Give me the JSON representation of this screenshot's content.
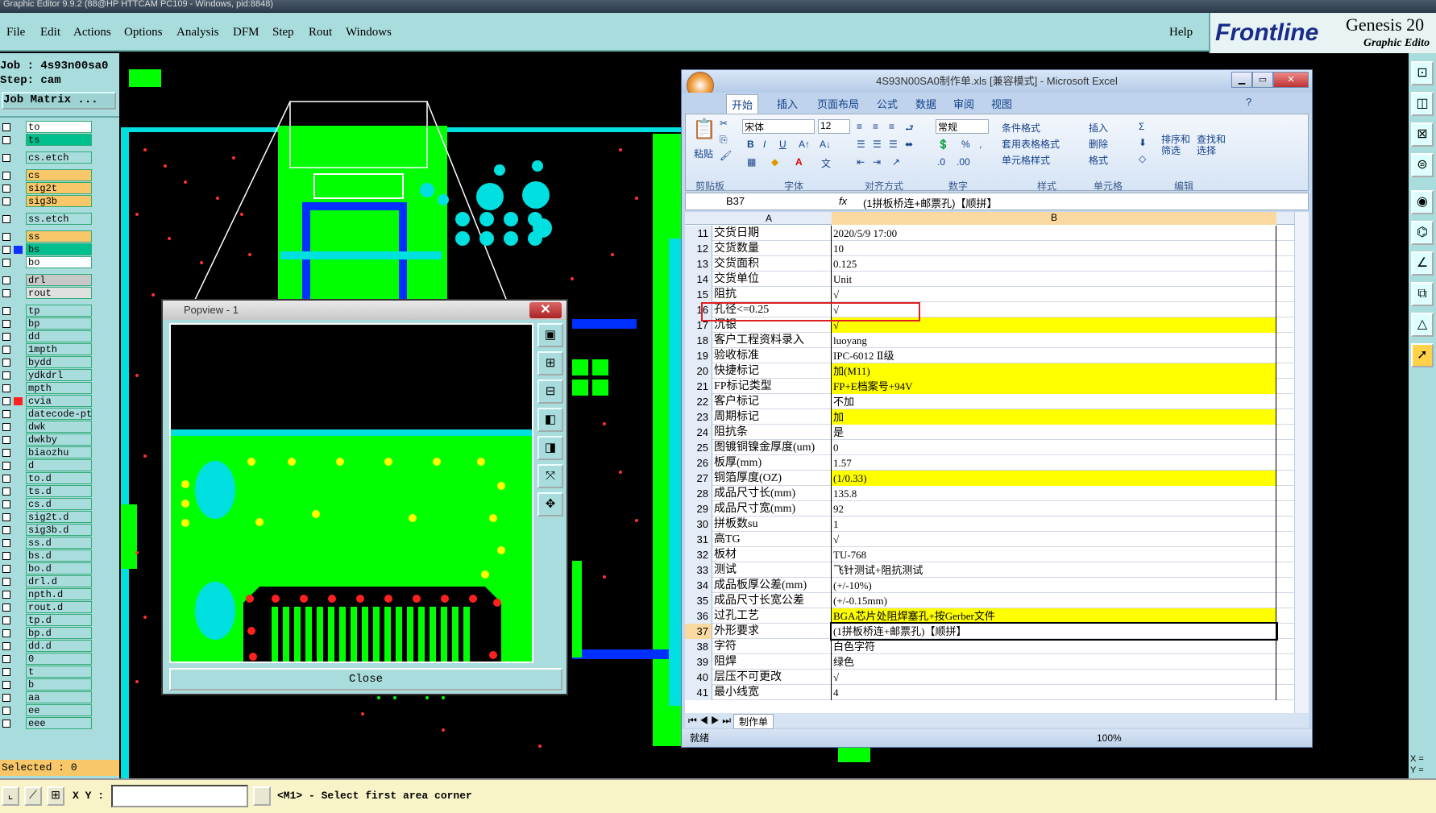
{
  "titlebar": {
    "text": "Graphic Editor 9.9.2 (88@HP HTTCAM PC109 - Windows, pid:8848)"
  },
  "menu": {
    "items": [
      "File",
      "Edit",
      "Actions",
      "Options",
      "Analysis",
      "DFM",
      "Step",
      "Rout",
      "Windows"
    ],
    "help": "Help"
  },
  "brand": {
    "logo": "Frontline",
    "product": "Genesis 20",
    "subtitle": "Graphic Edito"
  },
  "job": {
    "job_label": "Job : 4s93n00sa0",
    "step_label": "Step: cam",
    "matrix_button": "Job Matrix ..."
  },
  "layers": [
    {
      "name": "to",
      "color": "#ffffff"
    },
    {
      "name": "ts",
      "color": "#00c090"
    },
    {
      "name": "cs.etch",
      "color": "#a9dcdc"
    },
    {
      "name": "cs",
      "color": "#f7c76a"
    },
    {
      "name": "sig2t",
      "color": "#f7c76a"
    },
    {
      "name": "sig3b",
      "color": "#f7c76a"
    },
    {
      "name": "ss.etch",
      "color": "#a9dcdc"
    },
    {
      "name": "ss",
      "color": "#f7c76a"
    },
    {
      "name": "bs",
      "color": "#00c090"
    },
    {
      "name": "bo",
      "color": "#ffffff"
    },
    {
      "name": "drl",
      "color": "#c8c8c8"
    },
    {
      "name": "rout",
      "color": "#e0e0e0"
    },
    {
      "name": "tp",
      "color": "#a9dcdc"
    },
    {
      "name": "bp",
      "color": "#a9dcdc"
    },
    {
      "name": "dd",
      "color": "#a9dcdc"
    },
    {
      "name": "1mpth",
      "color": "#a9dcdc"
    },
    {
      "name": "bydd",
      "color": "#a9dcdc"
    },
    {
      "name": "ydkdrl",
      "color": "#a9dcdc"
    },
    {
      "name": "mpth",
      "color": "#a9dcdc"
    },
    {
      "name": "cvia",
      "color": "#a9dcdc"
    },
    {
      "name": "datecode-pt",
      "color": "#a9dcdc"
    },
    {
      "name": "dwk",
      "color": "#a9dcdc"
    },
    {
      "name": "dwkby",
      "color": "#a9dcdc"
    },
    {
      "name": "biaozhu",
      "color": "#a9dcdc"
    },
    {
      "name": "d",
      "color": "#a9dcdc"
    },
    {
      "name": "to.d",
      "color": "#a9dcdc"
    },
    {
      "name": "ts.d",
      "color": "#a9dcdc"
    },
    {
      "name": "cs.d",
      "color": "#a9dcdc"
    },
    {
      "name": "sig2t.d",
      "color": "#a9dcdc"
    },
    {
      "name": "sig3b.d",
      "color": "#a9dcdc"
    },
    {
      "name": "ss.d",
      "color": "#a9dcdc"
    },
    {
      "name": "bs.d",
      "color": "#a9dcdc"
    },
    {
      "name": "bo.d",
      "color": "#a9dcdc"
    },
    {
      "name": "drl.d",
      "color": "#a9dcdc"
    },
    {
      "name": "npth.d",
      "color": "#a9dcdc"
    },
    {
      "name": "rout.d",
      "color": "#a9dcdc"
    },
    {
      "name": "tp.d",
      "color": "#a9dcdc"
    },
    {
      "name": "bp.d",
      "color": "#a9dcdc"
    },
    {
      "name": "dd.d",
      "color": "#a9dcdc"
    },
    {
      "name": "0",
      "color": "#a9dcdc"
    },
    {
      "name": "t",
      "color": "#a9dcdc"
    },
    {
      "name": "b",
      "color": "#a9dcdc"
    },
    {
      "name": "aa",
      "color": "#a9dcdc"
    },
    {
      "name": "ee",
      "color": "#a9dcdc"
    },
    {
      "name": "eee",
      "color": "#a9dcdc"
    }
  ],
  "selected": "Selected : 0",
  "statusbar": {
    "xy_label": "X Y :",
    "xy_value": "",
    "prompt": "<M1> - Select first area corner"
  },
  "popview": {
    "title": "Popview - 1",
    "close_label": "Close"
  },
  "excel": {
    "title": "4S93N00SA0制作单.xls [兼容模式] - Microsoft Excel",
    "tabs": [
      "开始",
      "插入",
      "页面布局",
      "公式",
      "数据",
      "审阅",
      "视图"
    ],
    "groups": [
      "剪贴板",
      "字体",
      "对齐方式",
      "数字",
      "样式",
      "单元格",
      "编辑"
    ],
    "font_name": "宋体",
    "font_size": "12",
    "number_format": "常规",
    "buttons": {
      "paste": "粘贴",
      "cond": "条件格式",
      "table": "套用表格格式",
      "cellstyle": "单元格样式",
      "insert": "插入",
      "delete": "删除",
      "format": "格式",
      "sort": "排序和\n筛选",
      "find": "查找和\n选择"
    },
    "name_box": "B37",
    "formula": "(1拼板桥连+邮票孔)【顺拼】",
    "col_a": "A",
    "col_b": "B",
    "rows": [
      {
        "n": "11",
        "a": "交货日期",
        "b": "2020/5/9 17:00",
        "y": false
      },
      {
        "n": "12",
        "a": "交货数量",
        "b": "10",
        "y": false
      },
      {
        "n": "13",
        "a": "交货面积",
        "b": "0.125",
        "y": false
      },
      {
        "n": "14",
        "a": "交货单位",
        "b": "Unit",
        "y": false
      },
      {
        "n": "15",
        "a": "阻抗",
        "b": "√",
        "y": false
      },
      {
        "n": "16",
        "a": "孔径<=0.25",
        "b": "√",
        "y": false
      },
      {
        "n": "17",
        "a": "沉银",
        "b": "√",
        "y": true
      },
      {
        "n": "18",
        "a": "客户工程资料录入",
        "b": "luoyang",
        "y": false
      },
      {
        "n": "19",
        "a": "验收标准",
        "b": "IPC-6012 Ⅱ级",
        "y": false
      },
      {
        "n": "20",
        "a": "快捷标记",
        "b": "加(M11)",
        "y": true
      },
      {
        "n": "21",
        "a": "FP标记类型",
        "b": "FP+E档案号+94V",
        "y": true
      },
      {
        "n": "22",
        "a": "客户标记",
        "b": "不加",
        "y": false
      },
      {
        "n": "23",
        "a": "周期标记",
        "b": "加",
        "y": true
      },
      {
        "n": "24",
        "a": "阻抗条",
        "b": "是",
        "y": false
      },
      {
        "n": "25",
        "a": "图镀铜镍金厚度(um)",
        "b": "0",
        "y": false
      },
      {
        "n": "26",
        "a": "板厚(mm)",
        "b": "1.57",
        "y": false
      },
      {
        "n": "27",
        "a": "铜箔厚度(OZ)",
        "b": "(1/0.33)",
        "y": true
      },
      {
        "n": "28",
        "a": "成品尺寸长(mm)",
        "b": "135.8",
        "y": false
      },
      {
        "n": "29",
        "a": "成品尺寸宽(mm)",
        "b": "92",
        "y": false
      },
      {
        "n": "30",
        "a": "拼板数su",
        "b": "1",
        "y": false
      },
      {
        "n": "31",
        "a": "高TG",
        "b": "√",
        "y": false
      },
      {
        "n": "32",
        "a": "板材",
        "b": "TU-768",
        "y": false
      },
      {
        "n": "33",
        "a": "测试",
        "b": "飞针测试+阻抗测试",
        "y": false
      },
      {
        "n": "34",
        "a": "成品板厚公差(mm)",
        "b": "(+/-10%)",
        "y": false
      },
      {
        "n": "35",
        "a": "成品尺寸长宽公差",
        "b": "(+/-0.15mm)",
        "y": false
      },
      {
        "n": "36",
        "a": "过孔工艺",
        "b": "BGA芯片处阻焊塞孔+按Gerber文件",
        "y": true
      },
      {
        "n": "37",
        "a": "外形要求",
        "b": "(1拼板桥连+邮票孔)【顺拼】",
        "y": false
      },
      {
        "n": "38",
        "a": "字符",
        "b": "白色字符",
        "y": false
      },
      {
        "n": "39",
        "a": "阻焊",
        "b": "绿色",
        "y": false
      },
      {
        "n": "40",
        "a": "层压不可更改",
        "b": "√",
        "y": false
      },
      {
        "n": "41",
        "a": "最小线宽",
        "b": "4",
        "y": false
      }
    ],
    "sheet_tab": "制作单",
    "status": "就绪",
    "zoom": "100%"
  },
  "right_readout": {
    "x": "X =",
    "y": "Y ="
  }
}
